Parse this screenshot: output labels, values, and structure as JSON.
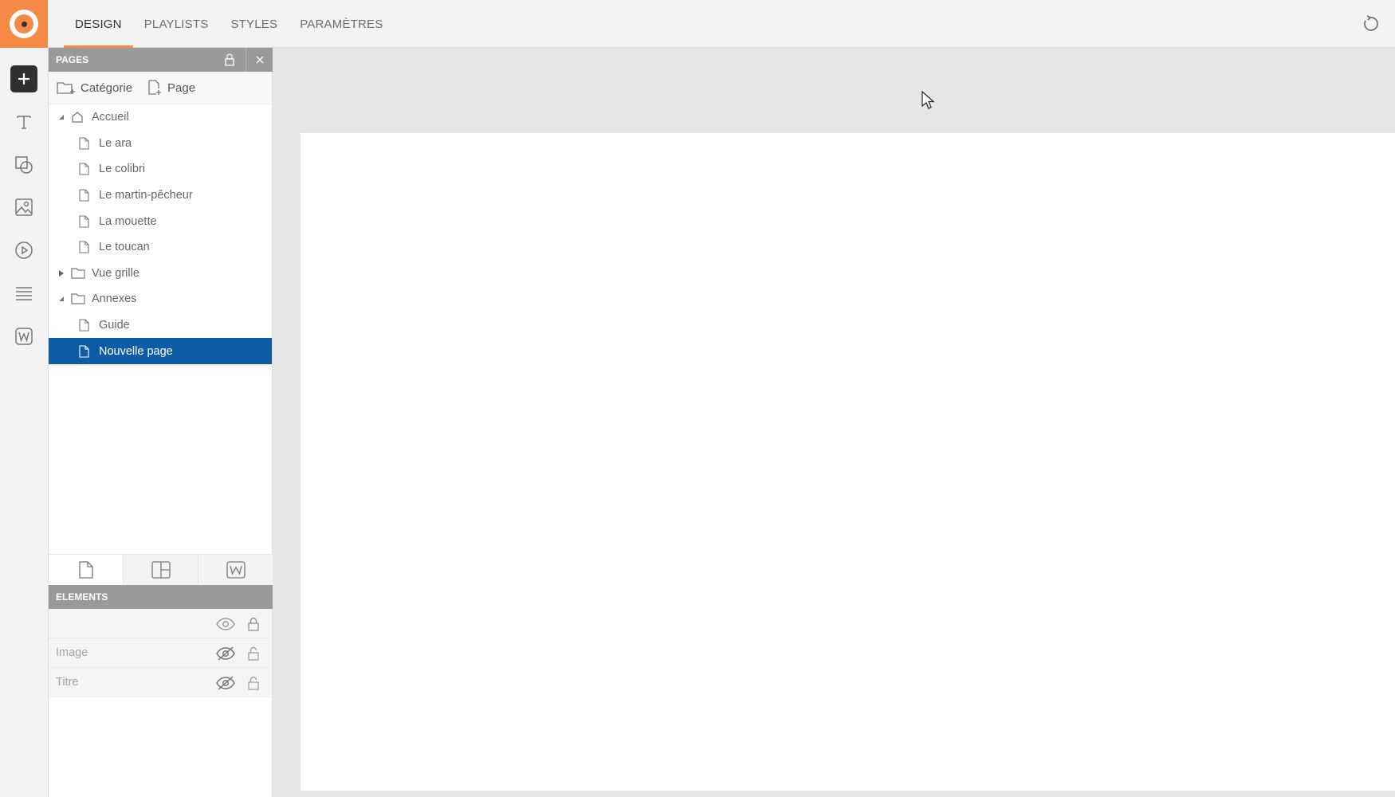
{
  "app": {
    "brand_color": "#f58a47",
    "selection_color": "#0f5ca6"
  },
  "topbar": {
    "tabs": [
      {
        "label": "DESIGN",
        "active": true
      },
      {
        "label": "PLAYLISTS",
        "active": false
      },
      {
        "label": "STYLES",
        "active": false
      },
      {
        "label": "PARAMÈTRES",
        "active": false
      }
    ],
    "undo_icon": "undo-icon"
  },
  "toolbar": {
    "tools": [
      "add-icon",
      "text-icon",
      "shapes-icon",
      "image-icon",
      "video-icon",
      "list-icon",
      "widget-icon"
    ]
  },
  "pages_panel": {
    "title": "PAGES",
    "add_category_label": "Catégorie",
    "add_page_label": "Page",
    "tree": [
      {
        "label": "Accueil",
        "type": "home",
        "expanded": true
      },
      {
        "label": "Le ara",
        "type": "page"
      },
      {
        "label": "Le colibri",
        "type": "page"
      },
      {
        "label": "Le martin-pêcheur",
        "type": "page"
      },
      {
        "label": "La mouette",
        "type": "page"
      },
      {
        "label": "Le toucan",
        "type": "page"
      },
      {
        "label": "Vue grille",
        "type": "folder",
        "expanded": false
      },
      {
        "label": "Annexes",
        "type": "folder",
        "expanded": true
      },
      {
        "label": "Guide",
        "type": "page"
      },
      {
        "label": "Nouvelle page",
        "type": "page",
        "selected": true
      }
    ],
    "view_tabs": [
      "page-view-icon",
      "layout-view-icon",
      "widget-view-icon"
    ]
  },
  "elements_panel": {
    "title": "ELEMENTS",
    "rows": [
      {
        "label": "",
        "visible": true,
        "locked": true
      },
      {
        "label": "Image",
        "visible": false,
        "locked": false
      },
      {
        "label": "Titre",
        "visible": false,
        "locked": false
      }
    ]
  }
}
